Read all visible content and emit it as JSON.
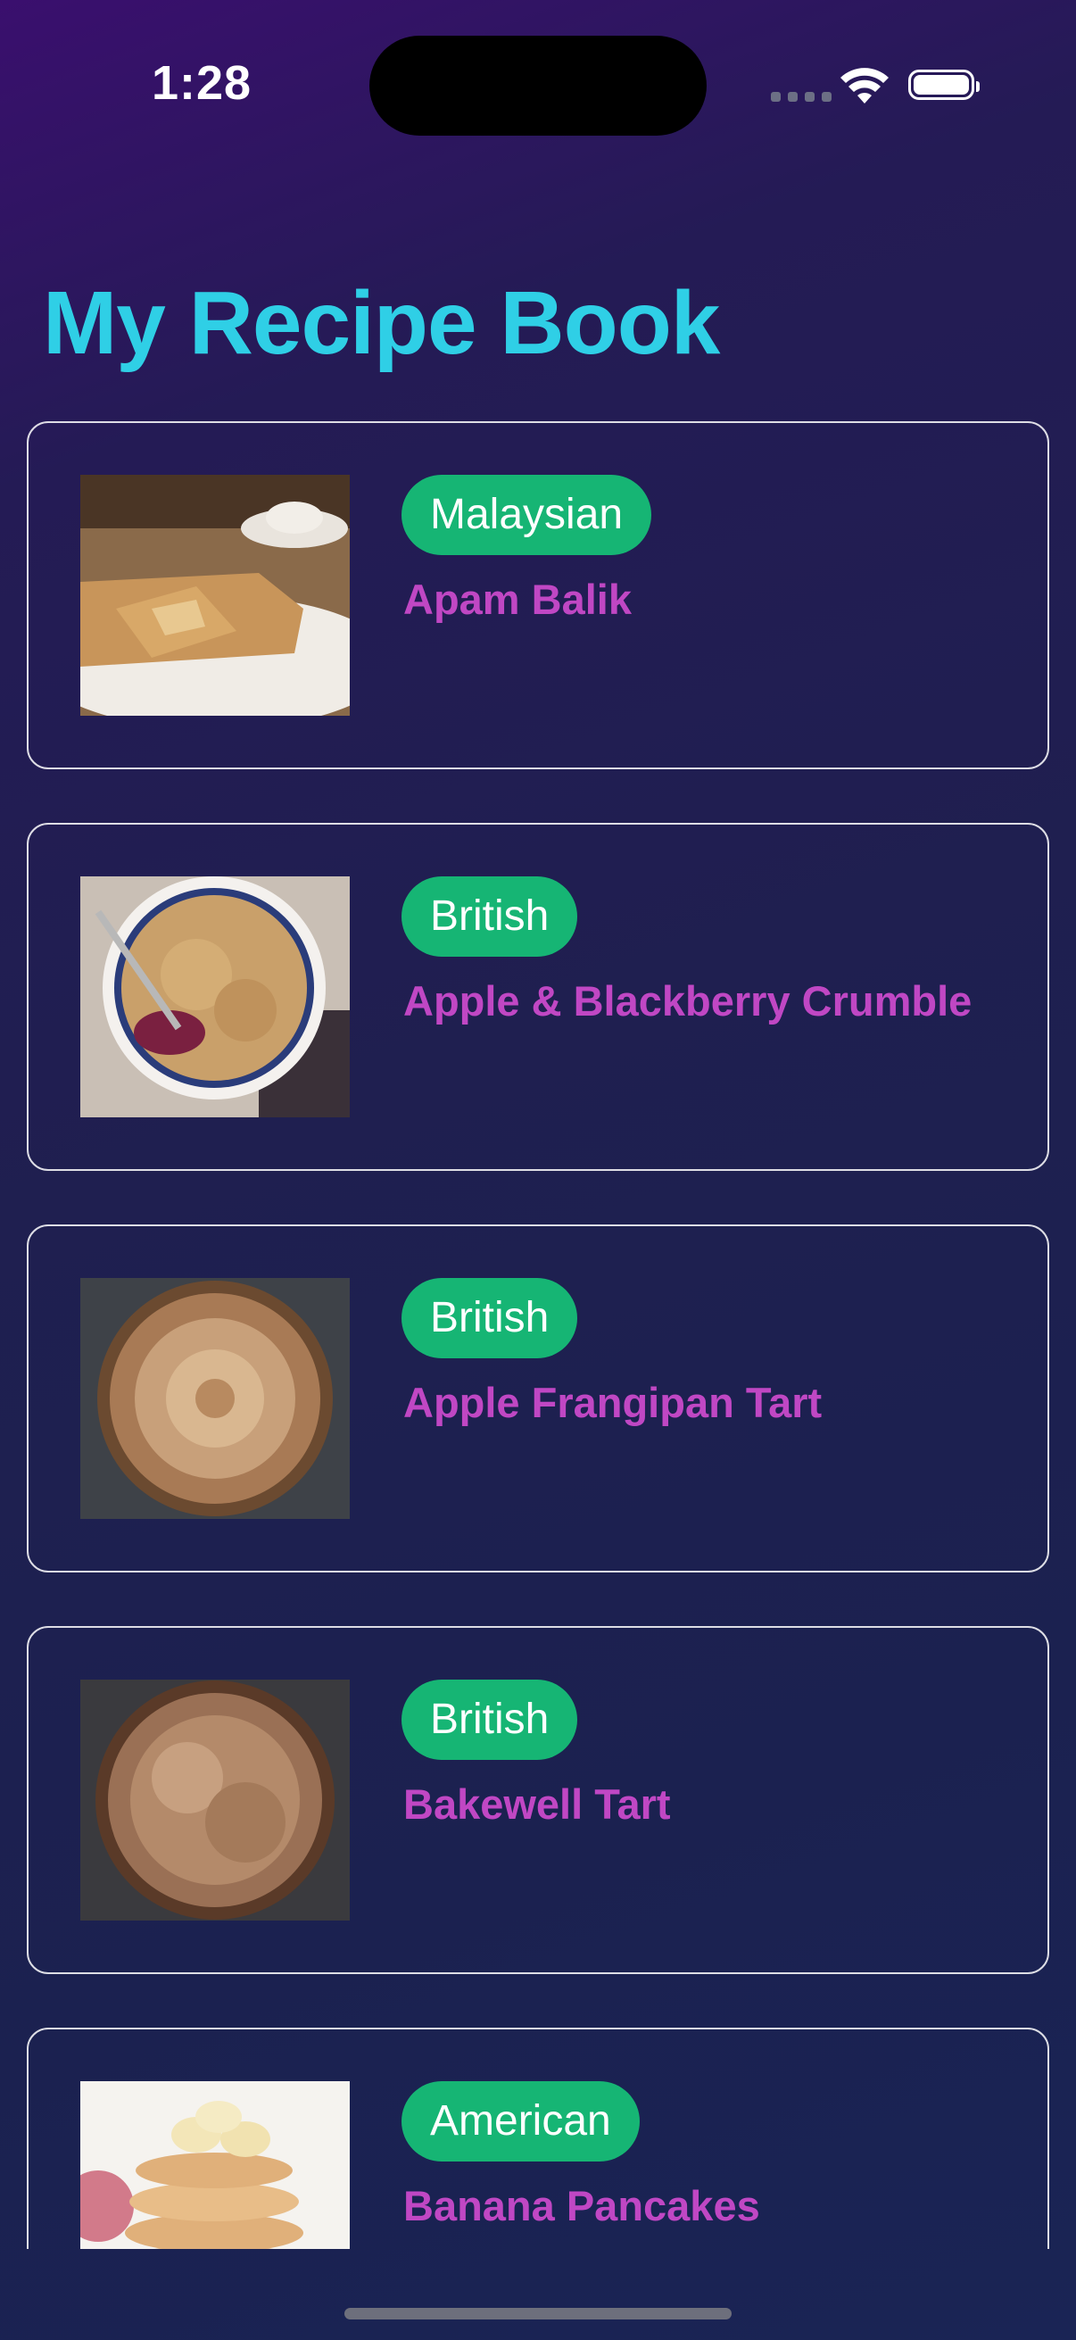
{
  "status_bar": {
    "time": "1:28",
    "icons": [
      "cellular-signal-icon",
      "wifi-icon",
      "battery-icon"
    ]
  },
  "header": {
    "title": "My Recipe Book"
  },
  "colors": {
    "title": "#2fcfe6",
    "tag_background": "#16b574",
    "recipe_name": "#c047c4"
  },
  "recipes": [
    {
      "cuisine": "Malaysian",
      "name": "Apam Balik",
      "image": "apam-balik-photo"
    },
    {
      "cuisine": "British",
      "name": "Apple & Blackberry Crumble",
      "image": "crumble-photo"
    },
    {
      "cuisine": "British",
      "name": "Apple Frangipan Tart",
      "image": "frangipan-tart-photo"
    },
    {
      "cuisine": "British",
      "name": "Bakewell Tart",
      "image": "bakewell-tart-photo"
    },
    {
      "cuisine": "American",
      "name": "Banana Pancakes",
      "image": "banana-pancakes-photo"
    }
  ]
}
